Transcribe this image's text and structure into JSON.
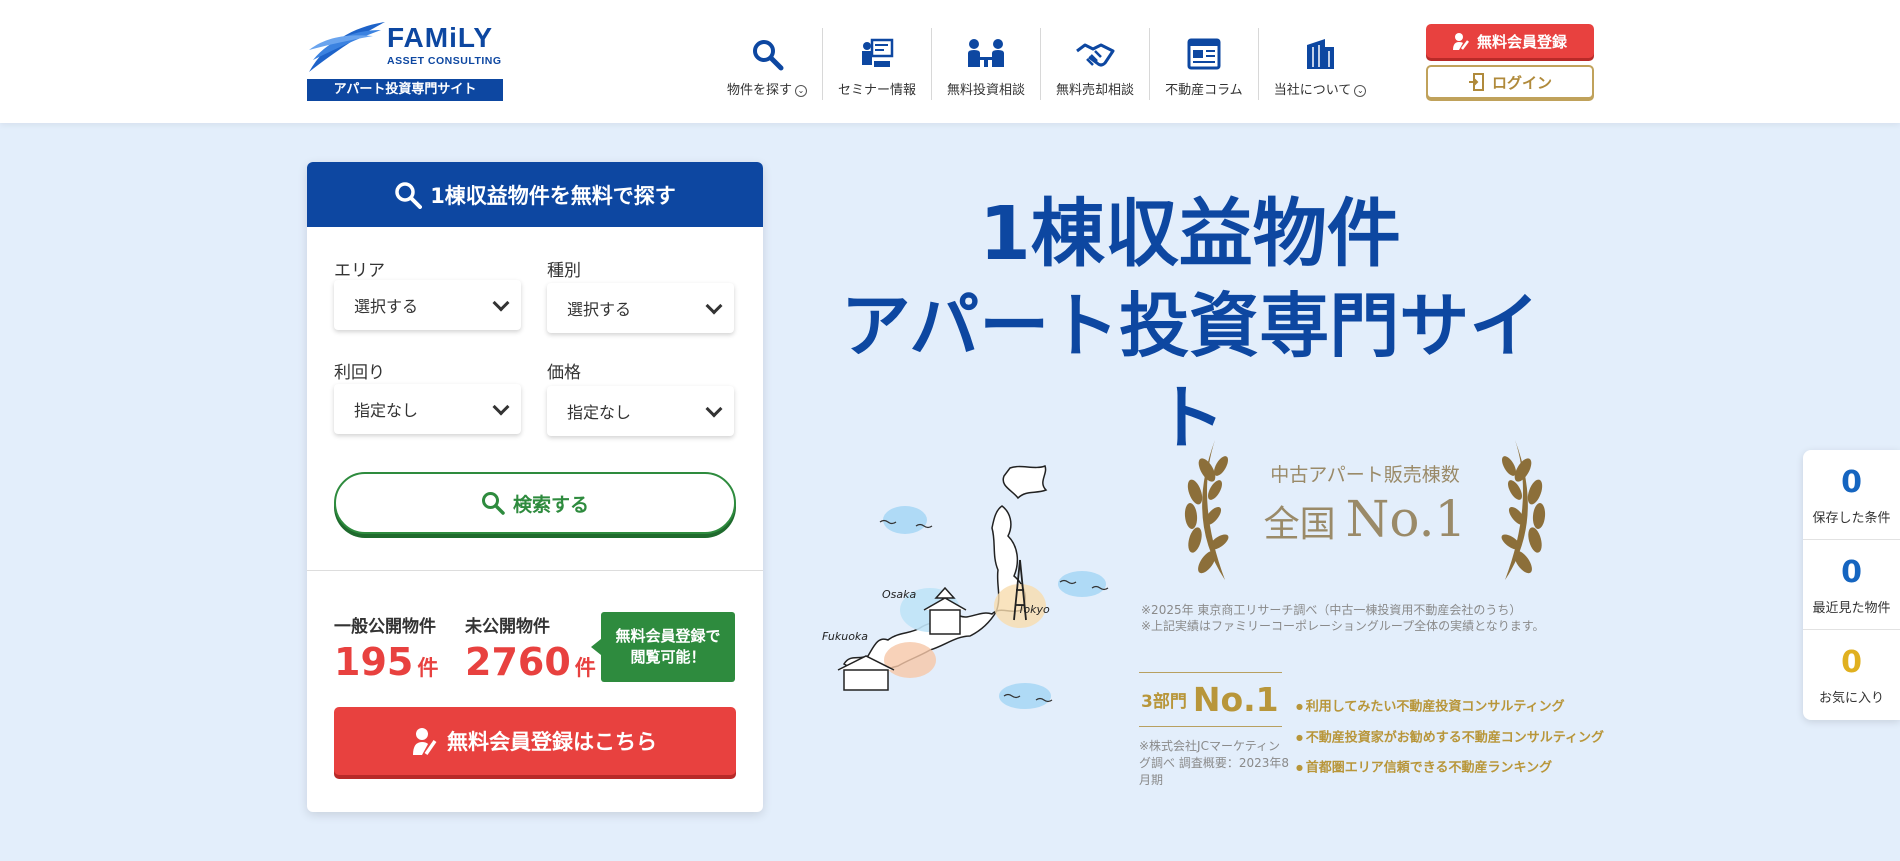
{
  "header": {
    "logo": {
      "word": "FAMiLY",
      "sub": "ASSET CONSULTING",
      "bar": "アパート投資専門サイト"
    },
    "nav": [
      {
        "label": "物件を探す",
        "icon": "search-icon",
        "dropdown": true
      },
      {
        "label": "セミナー情報",
        "icon": "seminar-icon",
        "dropdown": false
      },
      {
        "label": "無料投資相談",
        "icon": "consultation-icon",
        "dropdown": false
      },
      {
        "label": "無料売却相談",
        "icon": "handshake-icon",
        "dropdown": false
      },
      {
        "label": "不動産コラム",
        "icon": "column-icon",
        "dropdown": false
      },
      {
        "label": "当社について",
        "icon": "building-icon",
        "dropdown": true
      }
    ],
    "register_label": "無料会員登録",
    "login_label": "ログイン"
  },
  "search": {
    "title": "1棟収益物件を無料で探す",
    "fields": [
      {
        "label": "エリア",
        "value": "選択する"
      },
      {
        "label": "種別",
        "value": "選択する"
      },
      {
        "label": "利回り",
        "value": "指定なし"
      },
      {
        "label": "価格",
        "value": "指定なし"
      }
    ],
    "search_button": "検索する",
    "public_label": "一般公開物件",
    "public_count": "195",
    "private_label": "未公開物件",
    "private_count": "2760",
    "unit": "件",
    "badge_line1": "無料会員登録で",
    "badge_line2": "閲覧可能！",
    "register_button": "無料会員登録はこちら"
  },
  "hero": {
    "line1": "1棟収益物件",
    "line2": "アパート投資専門サイト",
    "map_labels": {
      "osaka": "Osaka",
      "tokyo": "Tokyo",
      "fukuoka": "Fukuoka"
    },
    "award_sub": "中古アパート販売棟数",
    "award_prefix": "全国",
    "award_main": "No.1",
    "award_note1": "※2025年 東京商工リサーチ調べ（中古一棟投資用不動産会社のうち）",
    "award_note2": "※上記実績はファミリーコーポレーショングループ全体の実績となります。",
    "rank_prefix": "3部門",
    "rank_main": "No.1",
    "rank_items": [
      "利用してみたい不動産投資コンサルティング",
      "不動産投資家がお勧めする不動産コンサルティング",
      "首都圏エリア信頼できる不動産ランキング"
    ],
    "rank_note": "※株式会社JCマーケティング調べ 調査概要：2023年8月期"
  },
  "sidebar": [
    {
      "count": "0",
      "label": "保存した条件"
    },
    {
      "count": "0",
      "label": "最近見た物件"
    },
    {
      "count": "0",
      "label": "お気に入り"
    }
  ],
  "colors": {
    "brand_blue": "#0d47a1",
    "red": "#e8413f",
    "green": "#2e8b3e",
    "gold": "#b8963a",
    "background": "#e3eefb"
  }
}
